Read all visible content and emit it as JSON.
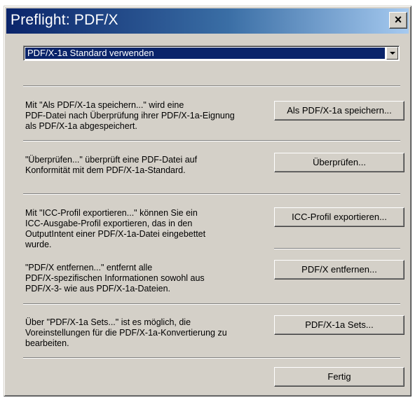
{
  "window": {
    "title": "Preflight: PDF/X",
    "close_label": "×"
  },
  "combo": {
    "selected": "PDF/X-1a Standard verwenden"
  },
  "sections": {
    "save": {
      "lines": [
        "Mit \"Als PDF/X-1a speichern...\" wird eine",
        "PDF-Datei nach Überprüfung ihrer PDF/X-1a-Eignung",
        "als PDF/X-1a abgespeichert."
      ],
      "button": "Als PDF/X-1a speichern..."
    },
    "check": {
      "lines": [
        "\"Überprüfen...\" überprüft eine PDF-Datei auf",
        "Konformität mit dem PDF/X-1a-Standard."
      ],
      "button": "Überprüfen..."
    },
    "icc": {
      "lines": [
        "Mit \"ICC-Profil exportieren...\" können Sie ein",
        "ICC-Ausgabe-Profil exportieren, das in den",
        "OutputIntent einer PDF/X-1a-Datei eingebettet",
        "wurde."
      ],
      "button": "ICC-Profil exportieren..."
    },
    "remove": {
      "lines": [
        "\"PDF/X entfernen...\" entfernt alle",
        "PDF/X-spezifischen Informationen sowohl aus",
        "PDF/X-3- wie aus PDF/X-1a-Dateien."
      ],
      "button": "PDF/X entfernen..."
    },
    "sets": {
      "lines": [
        "Über \"PDF/X-1a Sets...\" ist es möglich, die",
        "Voreinstellungen für die PDF/X-1a-Konvertierung zu",
        "bearbeiten."
      ],
      "button": "PDF/X-1a Sets..."
    }
  },
  "footer": {
    "done_button": "Fertig"
  }
}
